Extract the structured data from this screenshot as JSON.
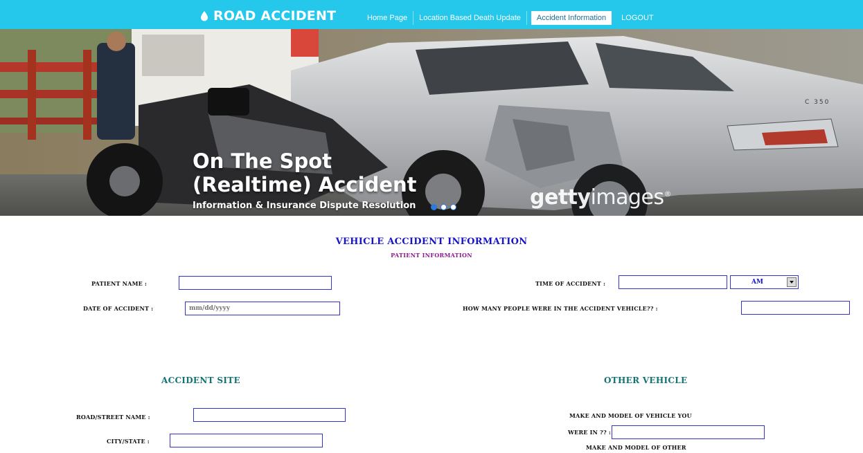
{
  "brand": {
    "name": "ROAD ACCIDENT",
    "icon": "droplet-icon"
  },
  "nav": [
    {
      "label": "Home Page"
    },
    {
      "label": "Location Based Death Update"
    },
    {
      "label": "Accident Information"
    },
    {
      "label": "LOGOUT"
    }
  ],
  "hero": {
    "title_line1": "On The Spot",
    "title_line2": "(Realtime) Accident",
    "subtitle": "Information & Insurance Dispute Resolution",
    "watermark_bold": "getty",
    "watermark_rest": "images",
    "watermark_mark": "®",
    "badge": "C 350"
  },
  "form": {
    "title": "VEHICLE ACCIDENT INFORMATION",
    "subtitle": "PATIENT INFORMATION",
    "patient_name_label": "PATIENT NAME  :",
    "date_label": "DATE OF ACCIDENT :",
    "date_placeholder": "mm/dd/yyyy",
    "time_label": "TIME OF ACCIDENT :",
    "ampm_value": "AM",
    "people_label": "HOW MANY PEOPLE WERE IN THE ACCIDENT VEHICLE?? :"
  },
  "accident_site": {
    "title": "ACCIDENT SITE",
    "road_label": "ROAD/STREET NAME  :",
    "city_label": "CITY/STATE :"
  },
  "other_vehicle": {
    "title": "OTHER VEHICLE",
    "make_model_line1": "MAKE AND MODEL OF VEHICLE YOU",
    "make_model_line2": "WERE IN ?? :",
    "make_model_other": "MAKE AND MODEL OF OTHER"
  },
  "colors": {
    "nav_bg": "#25c8ea",
    "form_title": "#1616c8",
    "form_sub": "#8b1a8b",
    "section": "#137373",
    "input_border": "#3333cc"
  }
}
